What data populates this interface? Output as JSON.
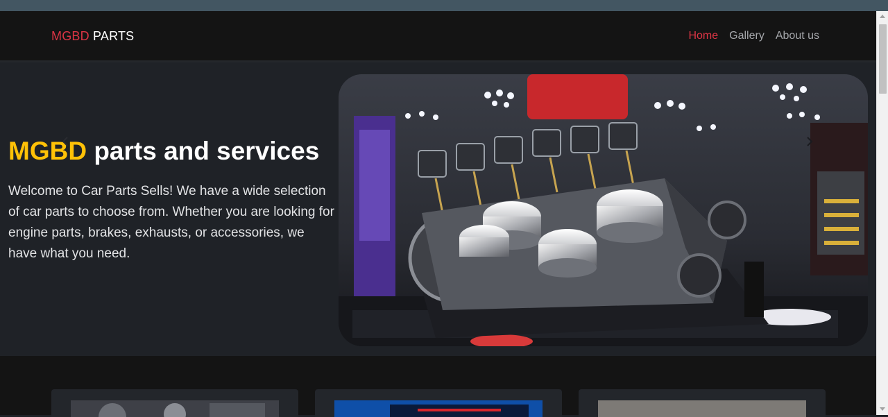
{
  "navbar": {
    "brand_part1": "MGBD",
    "brand_part2": "PARTS",
    "links": [
      {
        "label": "Home",
        "active": true
      },
      {
        "label": "Gallery",
        "active": false
      },
      {
        "label": "About us",
        "active": false
      }
    ]
  },
  "hero": {
    "title_accent": "MGBD",
    "title_rest": "parts and services",
    "description": "Welcome to Car Parts Sells! We have a wide selection of car parts to choose from. Whether you are looking for engine parts, brakes, exhausts, or accessories, we have what you need.",
    "carousel_image": "v8-engine-display-photo",
    "prev_icon": "chevron-left-icon",
    "next_icon": "chevron-right-icon"
  },
  "cards": [
    {
      "image": "engine-gears-photo"
    },
    {
      "image": "blue-car-photo"
    },
    {
      "image": "grey-texture-photo"
    }
  ],
  "colors": {
    "accent_red": "#dc3545",
    "accent_yellow": "#ffc107",
    "navbar_bg": "#141414",
    "hero_bg": "#1f2227"
  }
}
